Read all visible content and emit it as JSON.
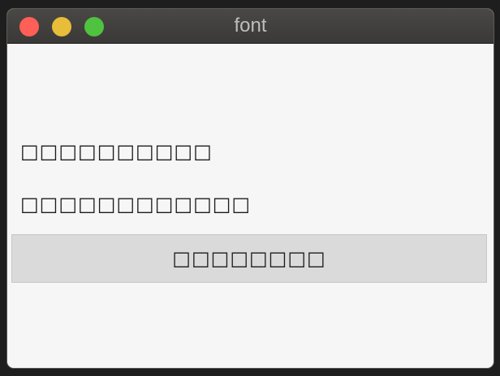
{
  "window": {
    "title": "font"
  },
  "labels": [
    "□□□□□□□□□□",
    "□□□□□□□□□□□□"
  ],
  "button": {
    "label": "□□□□□□□□"
  },
  "colors": {
    "close": "#ff5f57",
    "minimize": "#e7bd3a",
    "zoom": "#4fc23f",
    "titlebar": "#423f3d",
    "content_bg": "#f6f6f6",
    "button_bg": "#dadada"
  }
}
